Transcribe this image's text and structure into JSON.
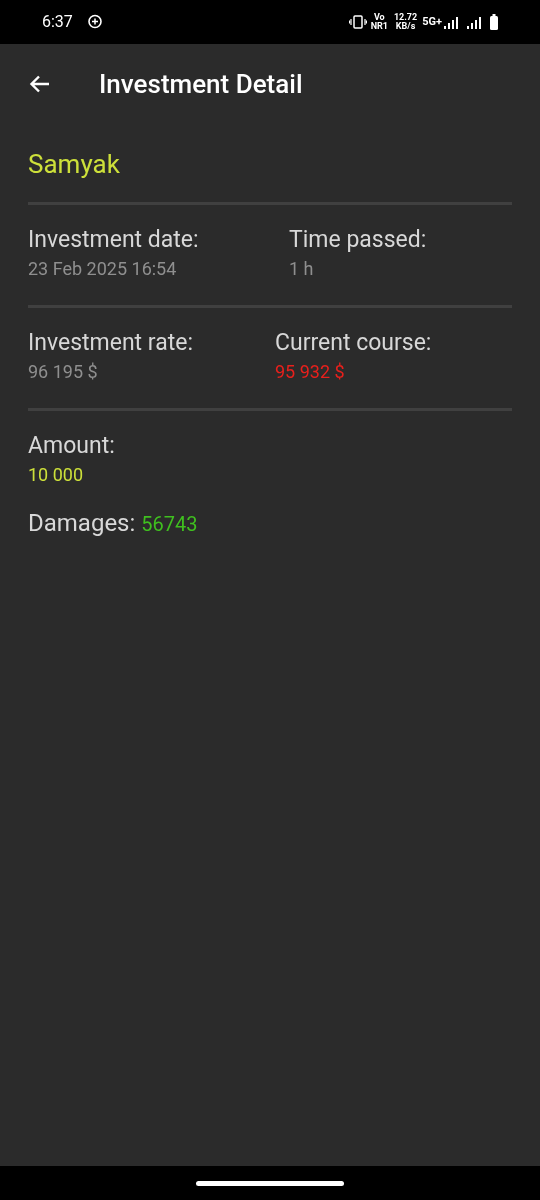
{
  "status_bar": {
    "time": "6:37",
    "volte": "Vo",
    "nr": "NR1",
    "speed": "12.72",
    "speed_unit": "KB/s",
    "network": "5G+"
  },
  "app_bar": {
    "title": "Investment Detail"
  },
  "name": "Samyak",
  "rows": [
    {
      "fields": [
        {
          "label": "Investment date:",
          "value": "23 Feb 2025 16:54",
          "color": "#8f8f8f"
        },
        {
          "label": "Time passed:",
          "value": "1 h",
          "color": "#8f8f8f"
        }
      ]
    },
    {
      "fields": [
        {
          "label": "Investment rate:",
          "value": "96 195 $",
          "color": "#8f8f8f"
        },
        {
          "label": "Current course:",
          "value": "95 932 $",
          "color": "#e8201c"
        }
      ]
    },
    {
      "fields": [
        {
          "label": "Amount:",
          "value": "10 000",
          "color": "#cde03a"
        }
      ]
    }
  ],
  "damages": {
    "label": "Damages:",
    "value": "56743",
    "color": "#3fbf1f"
  }
}
